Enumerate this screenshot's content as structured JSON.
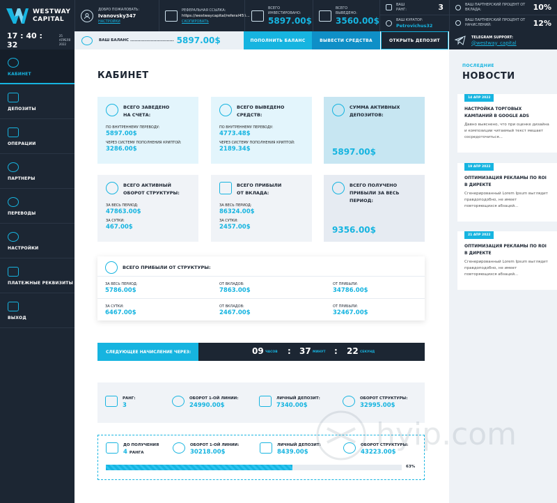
{
  "brand": {
    "line1": "WESTWAY",
    "line2": "CAPITAL"
  },
  "header": {
    "welcome_label": "ДОБРО ПОЖАЛОВАТЬ:",
    "username": "Ivanovsky347",
    "settings_link": "НАСТРОЙКИ",
    "ref_label": "РЕФЕРАЛЬНАЯ ССЫЛКА:",
    "ref_link": "https://westwaycapital/referal455...",
    "copy_link": "СКОПИРОВАТЬ",
    "invested_label_1": "ВСЕГО",
    "invested_label_2": "ИНВЕСТИРОВАНО:",
    "invested_value": "5897.00$",
    "withdrawn_label_1": "ВСЕГО",
    "withdrawn_label_2": "ВЫВЕДЕНО:",
    "withdrawn_value": "3560.00$",
    "rank_label_1": "ВАШ",
    "rank_label_2": "РАНГ:",
    "rank_value": "3",
    "curator_label": "ВАШ КУРАТОР:",
    "curator_value": "Petrovichus32",
    "partner_deposit_label": "ВАШ ПАРТНЕРСКИЙ ПРОЦЕНТ ОТ ВКЛАДА:",
    "partner_deposit_value": "10%",
    "partner_accrual_label": "ВАШ ПАРТНЕРСКИЙ ПРОЦЕНТ ОТ НАЧИСЛЕНИЙ:",
    "partner_accrual_value": "12%"
  },
  "toolbar": {
    "time": "17 : 40 : 32",
    "date_line1": "25 АПРЕЛЯ",
    "date_line2": "2022",
    "balance_label": "ВАШ БАЛАНС ..............................",
    "balance_value": "5897.00$",
    "topup_label": "ПОПОЛНИТЬ БАЛАНС",
    "withdraw_label": "ВЫВЕСТИ СРЕДСТВА",
    "open_deposit_label": "ОТКРЫТЬ ДЕПОЗИТ",
    "telegram_label": "TELEGRAM SUPPORT:",
    "telegram_handle": "@westway_capital"
  },
  "sidebar": {
    "items": [
      {
        "label": "КАБИНЕТ"
      },
      {
        "label": "ДЕПОЗИТЫ"
      },
      {
        "label": "ОПЕРАЦИИ"
      },
      {
        "label": "ПАРТНЕРЫ"
      },
      {
        "label": "ПЕРЕВОДЫ"
      },
      {
        "label": "НАСТРОЙКИ"
      },
      {
        "label": "ПЛАТЕЖНЫЕ РЕКВИЗИТЫ"
      },
      {
        "label": "ВЫХОД"
      }
    ]
  },
  "main": {
    "title": "КАБИНЕТ",
    "card1": {
      "t1": "ВСЕГО ЗАВЕДЕНО",
      "t2": "НА СЧЕТА:",
      "l1": "ПО ВНУТРЕННЕМУ ПЕРЕВОДУ:",
      "v1": "5897.00$",
      "l2": "ЧЕРЕЗ СИСТЕМУ ПОПОЛНЕНИЯ КРИПТОЙ:",
      "v2": "3286.00$"
    },
    "card2": {
      "t1": "ВСЕГО ВЫВЕДЕНО",
      "t2": "СРЕДСТВ:",
      "l1": "ПО ВНУТРЕННЕМУ ПЕРЕВОДУ:",
      "v1": "4773.48$",
      "l2": "ЧЕРЕЗ СИСТЕМУ ПОПОЛНЕНИЯ КРИПТОЙ:",
      "v2": "2189.34$"
    },
    "card3": {
      "t1": "СУММА АКТИВНЫХ",
      "t2": "ДЕПОЗИТОВ:",
      "big": "5897.00$"
    },
    "card4": {
      "t1": "ВСЕГО АКТИВНЫЙ",
      "t2": "ОБОРОТ СТРУКТУРЫ:",
      "l1": "ЗА ВЕСЬ ПЕРИОД:",
      "v1": "47863.00$",
      "l2": "ЗА СУТКИ:",
      "v2": "467.00$"
    },
    "card5": {
      "t1": "ВСЕГО ПРИБЫЛИ",
      "t2": "ОТ ВКЛАДА:",
      "l1": "ЗА ВЕСЬ ПЕРИОД:",
      "v1": "86324.00$",
      "l2": "ЗА СУТКИ:",
      "v2": "2457.00$"
    },
    "card6": {
      "t1": "ВСЕГО ПОЛУЧЕНО",
      "t2": "ПРИБЫЛИ ЗА ВЕСЬ",
      "t3": "ПЕРИОД:",
      "big": "9356.00$"
    },
    "struct": {
      "title": "ВСЕГО ПРИБЫЛИ ОТ СТРУКТУРЫ:",
      "r1": [
        {
          "l": "ЗА ВЕСЬ ПЕРИОД:",
          "v": "5786.00$"
        },
        {
          "l": "ОТ ВКЛАДОВ:",
          "v": "7863.00$"
        },
        {
          "l": "ОТ ПРИБЫЛИ:",
          "v": "34786.00$"
        }
      ],
      "r2": [
        {
          "l": "ЗА СУТКИ:",
          "v": "6467.00$"
        },
        {
          "l": "ОТ ВКЛАДОВ:",
          "v": "2467.00$"
        },
        {
          "l": "ОТ ПРИБЫЛИ:",
          "v": "32467.00$"
        }
      ]
    },
    "timer": {
      "label": "СЛЕДУЮЩЕЕ НАЧИСЛЕНИЕ ЧЕРЕЗ:",
      "hours": "09",
      "hours_unit": "ЧАСОВ",
      "minutes": "37",
      "minutes_unit": "МИНУТ",
      "seconds": "22",
      "seconds_unit": "СЕКУНД"
    },
    "rank": {
      "rank_label": "РАНГ:",
      "rank_value": "3",
      "line1_label": "ОБОРОТ 1-ОЙ ЛИНИИ:",
      "line1_value": "24990.00$",
      "personal_label": "ЛИЧНЫЙ ДЕПОЗИТ:",
      "personal_value": "7340.00$",
      "struct_label": "ОБОРОТ СТРУКТУРЫ:",
      "struct_value": "32995.00$"
    },
    "next_rank": {
      "label": "ДО ПОЛУЧЕНИЯ",
      "value": "4",
      "value_suffix": "РАНГА",
      "line1_label": "ОБОРОТ 1-ОЙ ЛИНИИ:",
      "line1_value": "30218.00$",
      "personal_label": "ЛИЧНЫЙ ДЕПОЗИТ:",
      "personal_value": "8439.00$",
      "struct_label": "ОБОРОТ СТРУКТУРЫ:",
      "struct_value": "43223.00$",
      "progress": 0.63,
      "progress_text": "63%"
    }
  },
  "news": {
    "subtitle": "ПОСЛЕДНИЕ",
    "title": "НОВОСТИ",
    "items": [
      {
        "date": "14 АПР 2022",
        "title": "НАСТРОЙКА ТОРГОВЫХ КАМПАНИЙ В GOOGLE ADS",
        "text": "Давно выяснено, что при оценке дизайна и композиции читаемый текст мешает сосредоточиться..."
      },
      {
        "date": "19 АПР 2022",
        "title": "ОПТИМИЗАЦИЯ РЕКЛАМЫ ПО ROI В ДИРЕКТЕ",
        "text": "Сгенерированный Lorem Ipsum выглядит правдоподобно, не имеет повторяющихся абзацей..."
      },
      {
        "date": "21 АПР 2022",
        "title": "ОПТИМИЗАЦИЯ РЕКЛАМЫ ПО ROI В ДИРЕКТЕ",
        "text": "Сгенерированный Lorem Ipsum выглядит правдоподобно, не имеет повторяющихся абзацей..."
      }
    ]
  },
  "watermark": "hyip.com",
  "colors": {
    "accent": "#16b4e0",
    "dark": "#1c2633",
    "button_blue": "#0f8fc7",
    "card_light": "#e3f5fc",
    "card_grey": "#f0f3f7"
  }
}
